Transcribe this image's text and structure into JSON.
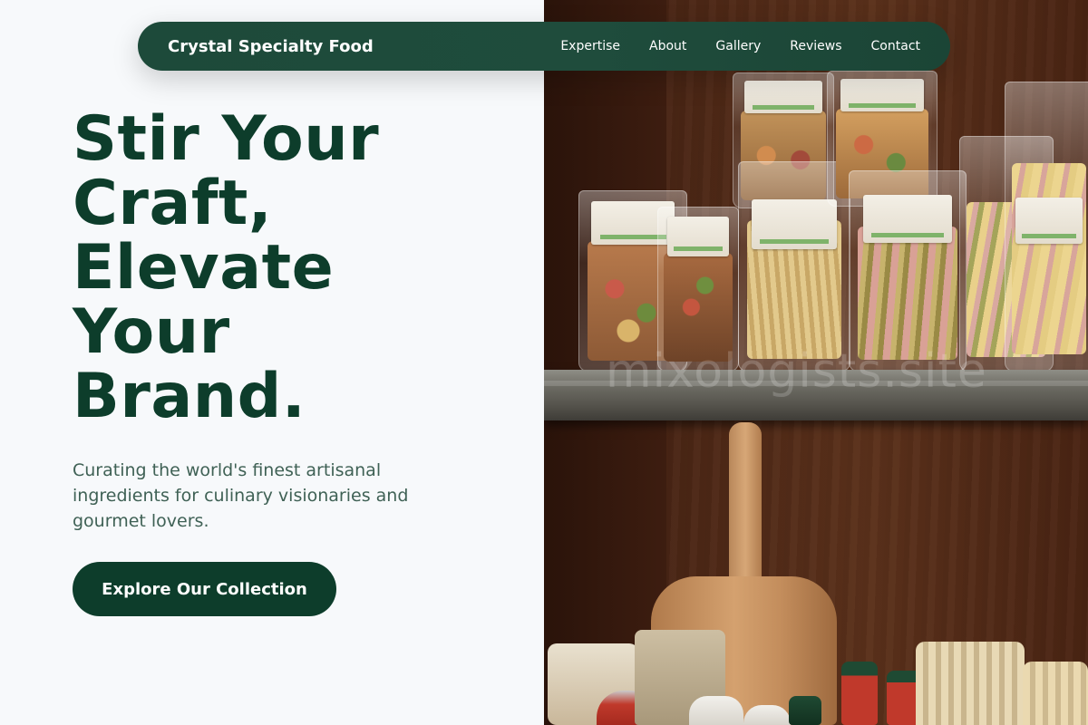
{
  "navbar": {
    "brand": "Crystal Specialty Food",
    "links": [
      "Expertise",
      "About",
      "Gallery",
      "Reviews",
      "Contact"
    ]
  },
  "hero": {
    "headline_lines": [
      "Stir Your",
      "Craft,",
      "Elevate",
      "Your",
      "Brand."
    ],
    "subtext": "Curating the world's finest artisanal ingredients for culinary visionaries and gourmet lovers.",
    "cta_label": "Explore Our Collection"
  },
  "image": {
    "watermark": "mixologists.site"
  },
  "colors": {
    "primary": "#0d3d2b",
    "nav_bg": "#1f4c3c",
    "subtext": "#3f6155",
    "page_bg": "#f7f9fb"
  }
}
